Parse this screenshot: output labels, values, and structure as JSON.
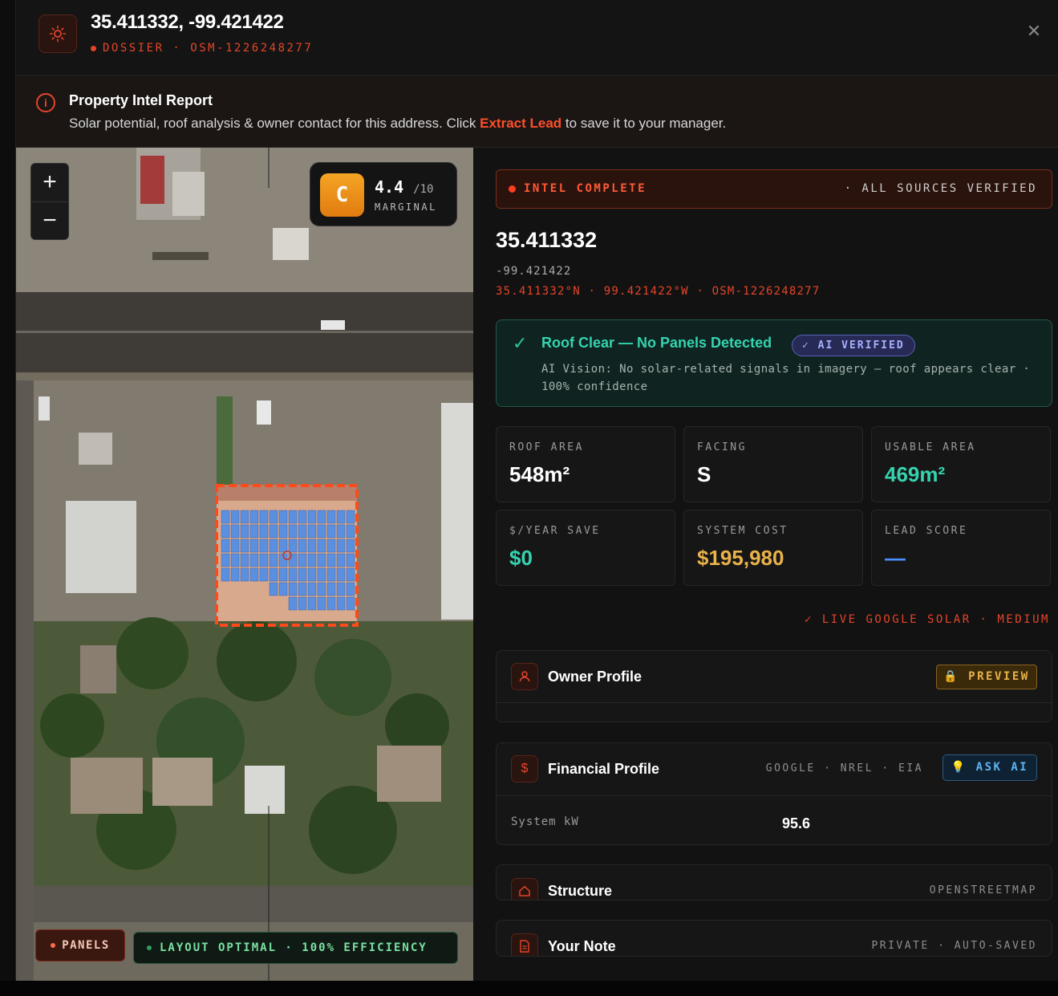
{
  "header": {
    "title": "35.411332, -99.421422",
    "subtitle": "DOSSIER · OSM-1226248277"
  },
  "banner": {
    "title": "Property Intel Report",
    "text_before": "Solar potential, roof analysis & owner contact for this address. Click ",
    "highlight": "Extract Lead",
    "text_after": " to save it to your manager."
  },
  "map": {
    "zoom_in": "+",
    "zoom_out": "−",
    "grade": "C",
    "score": "4.4",
    "score_max": "/10",
    "score_label": "MARGINAL",
    "panels_chip": "PANELS",
    "layout_chip": "LAYOUT OPTIMAL · 100% EFFICIENCY"
  },
  "status": {
    "left": "INTEL COMPLETE",
    "right": "· ALL SOURCES VERIFIED"
  },
  "location": {
    "lat": "35.411332",
    "lng": "-99.421422",
    "coord_line": "35.411332°N · 99.421422°W · OSM-1226248277"
  },
  "roof": {
    "title": "Roof Clear — No Panels Detected",
    "badge": "✓ AI VERIFIED",
    "desc": "AI Vision: No solar-related signals in imagery — roof appears clear · 100% confidence"
  },
  "stats": [
    {
      "label": "ROOF AREA",
      "value": "548m²"
    },
    {
      "label": "FACING",
      "value": "S"
    },
    {
      "label": "USABLE AREA",
      "value": "469m²"
    },
    {
      "label": "$/YEAR SAVE",
      "value": "$0"
    },
    {
      "label": "SYSTEM COST",
      "value": "$195,980"
    },
    {
      "label": "LEAD SCORE",
      "value": "—"
    }
  ],
  "source_line": "✓ LIVE GOOGLE SOLAR · MEDIUM",
  "sections": {
    "owner": {
      "title": "Owner Profile",
      "button": "PREVIEW"
    },
    "financial": {
      "title": "Financial Profile",
      "sources": "GOOGLE · NREL · EIA",
      "button": "ASK AI",
      "row_label": "System kW",
      "row_value": "95.6"
    },
    "structure": {
      "title": "Structure",
      "source": "OPENSTREETMAP"
    },
    "note": {
      "title": "Your Note",
      "meta": "PRIVATE · AUTO-SAVED"
    }
  },
  "colors": {
    "accent": "#e4452a",
    "teal": "#35d3b0",
    "gold": "#e9b24a",
    "blue": "#4a8fff"
  }
}
